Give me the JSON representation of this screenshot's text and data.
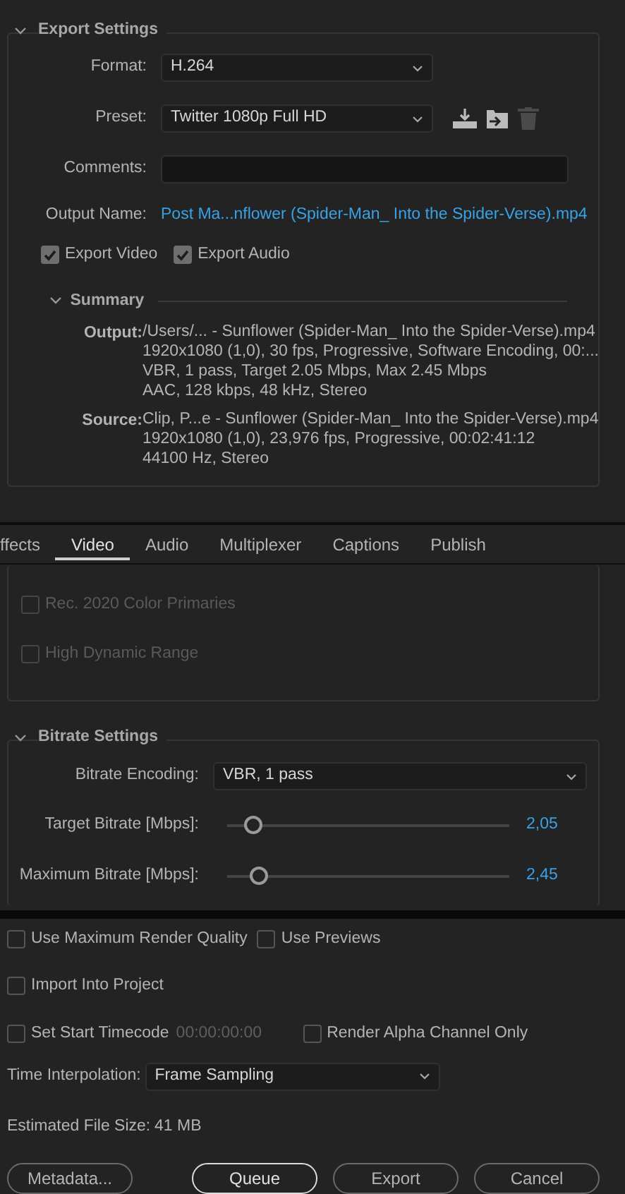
{
  "export_settings": {
    "title": "Export Settings",
    "expanded": true,
    "format": {
      "label": "Format:",
      "value": "H.264"
    },
    "preset": {
      "label": "Preset:",
      "value": "Twitter 1080p Full HD"
    },
    "comments": {
      "label": "Comments:"
    },
    "output_name": {
      "label": "Output Name:",
      "value": "Post Ma...nflower (Spider-Man_ Into the Spider-Verse).mp4"
    },
    "checkboxes": [
      {
        "label": "Export Video",
        "checked": true
      },
      {
        "label": "Export Audio",
        "checked": true
      }
    ],
    "summary": {
      "title": "Summary",
      "expanded": true,
      "entries": [
        {
          "label": "Output:",
          "lines": [
            "/Users/... - Sunflower (Spider-Man_ Into the Spider-Verse).mp4",
            "1920x1080 (1,0), 30 fps, Progressive, Software Encoding, 00:...",
            "VBR, 1 pass, Target 2.05 Mbps, Max 2.45 Mbps",
            "AAC, 128 kbps, 48 kHz, Stereo"
          ]
        },
        {
          "label": "Source:",
          "lines": [
            "Clip, P...e - Sunflower (Spider-Man_ Into the Spider-Verse).mp4",
            "1920x1080 (1,0), 23,976 fps, Progressive, 00:02:41:12",
            "44100 Hz, Stereo"
          ]
        }
      ]
    }
  },
  "tabs": [
    {
      "label": "ffects",
      "selected": false
    },
    {
      "label": "Video",
      "selected": true
    },
    {
      "label": "Audio",
      "selected": false
    },
    {
      "label": "Multiplexer",
      "selected": false
    },
    {
      "label": "Captions",
      "selected": false
    },
    {
      "label": "Publish",
      "selected": false
    }
  ],
  "video": {
    "checkboxes": [
      {
        "label": "Rec. 2020 Color Primaries",
        "checked": false,
        "disabled": true
      },
      {
        "label": "High Dynamic Range",
        "checked": false,
        "disabled": true
      }
    ]
  },
  "bitrate_settings": {
    "title": "Bitrate Settings",
    "expanded": true,
    "encoding": {
      "label": "Bitrate Encoding:",
      "value": "VBR, 1 pass"
    },
    "sliders": [
      {
        "label": "Target Bitrate [Mbps]:",
        "level": 0.09,
        "reading": "2,05"
      },
      {
        "label": "Maximum Bitrate [Mbps]:",
        "level": 0.11,
        "reading": "2,45"
      }
    ]
  },
  "options": [
    [
      {
        "label": "Use Maximum Render Quality",
        "checked": false
      },
      {
        "label": "Use Previews",
        "checked": false
      }
    ],
    [
      {
        "label": "Import Into Project",
        "checked": false
      }
    ],
    [
      {
        "label": "Set Start Timecode",
        "checked": false,
        "timecode": "00:00:00:00"
      },
      {
        "label": "Render Alpha Channel Only",
        "checked": false
      }
    ]
  ],
  "time_interpolation": {
    "label": "Time Interpolation:",
    "value": "Frame Sampling"
  },
  "file_size": {
    "label": "Estimated File Size:",
    "value": "41 MB"
  },
  "buttons": [
    {
      "label": "Metadata...",
      "default": false
    },
    {
      "label": "Queue",
      "default": true
    },
    {
      "label": "Export",
      "default": false
    },
    {
      "label": "Cancel",
      "default": false
    }
  ]
}
